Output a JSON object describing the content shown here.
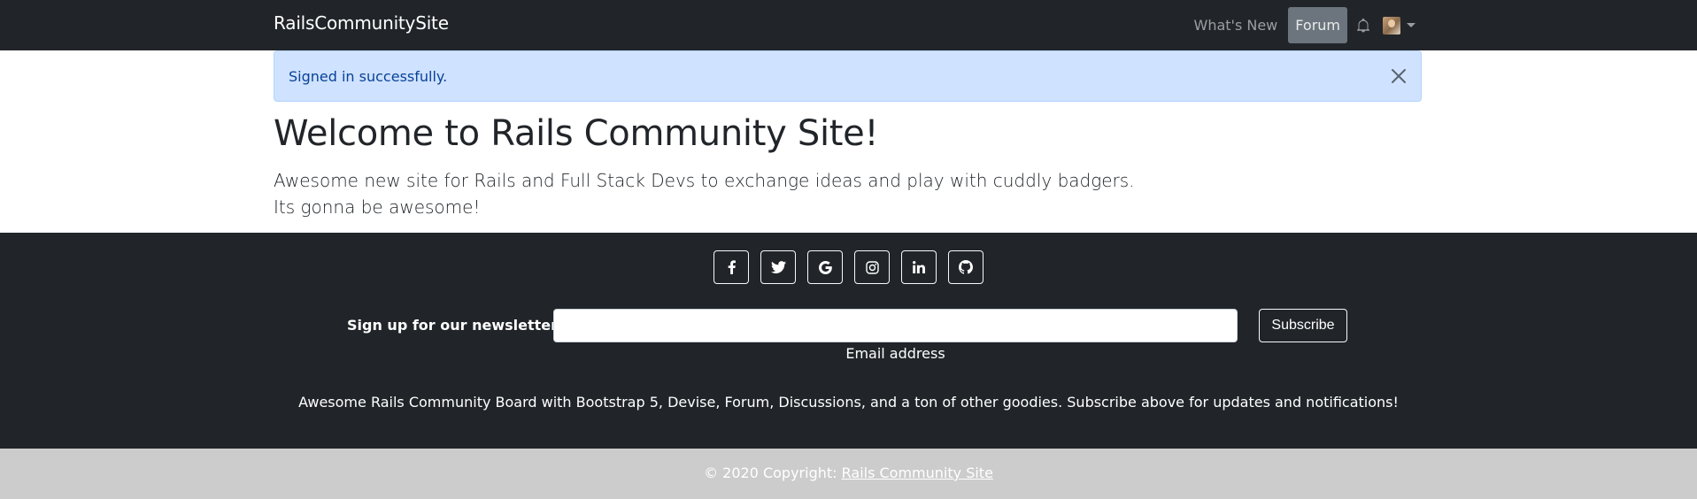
{
  "navbar": {
    "brand": "RailsCommunitySite",
    "links": [
      {
        "label": "What's New"
      },
      {
        "label": "Forum"
      }
    ],
    "bell_icon": "bell-icon",
    "avatar_icon": "user-avatar"
  },
  "alert": {
    "message": "Signed in successfully.",
    "close_icon": "close-icon"
  },
  "hero": {
    "title": "Welcome to Rails Community Site!",
    "lead_line1": "Awesome new site for Rails and Full Stack Devs to exchange ideas and play with cuddly badgers.",
    "lead_line2": "Its gonna be awesome!"
  },
  "footer": {
    "social_icons": [
      "facebook-icon",
      "twitter-icon",
      "google-icon",
      "instagram-icon",
      "linkedin-icon",
      "github-icon"
    ],
    "newsletter_label": "Sign up for our newsletter",
    "email_value": "",
    "email_help": "Email address",
    "subscribe_label": "Subscribe",
    "description": "Awesome Rails Community Board with Bootstrap 5, Devise, Forum, Discussions, and a ton of other goodies. Subscribe above for updates and notifications!"
  },
  "copyright": {
    "prefix": "© 2020 Copyright: ",
    "link_text": "Rails Community Site"
  }
}
